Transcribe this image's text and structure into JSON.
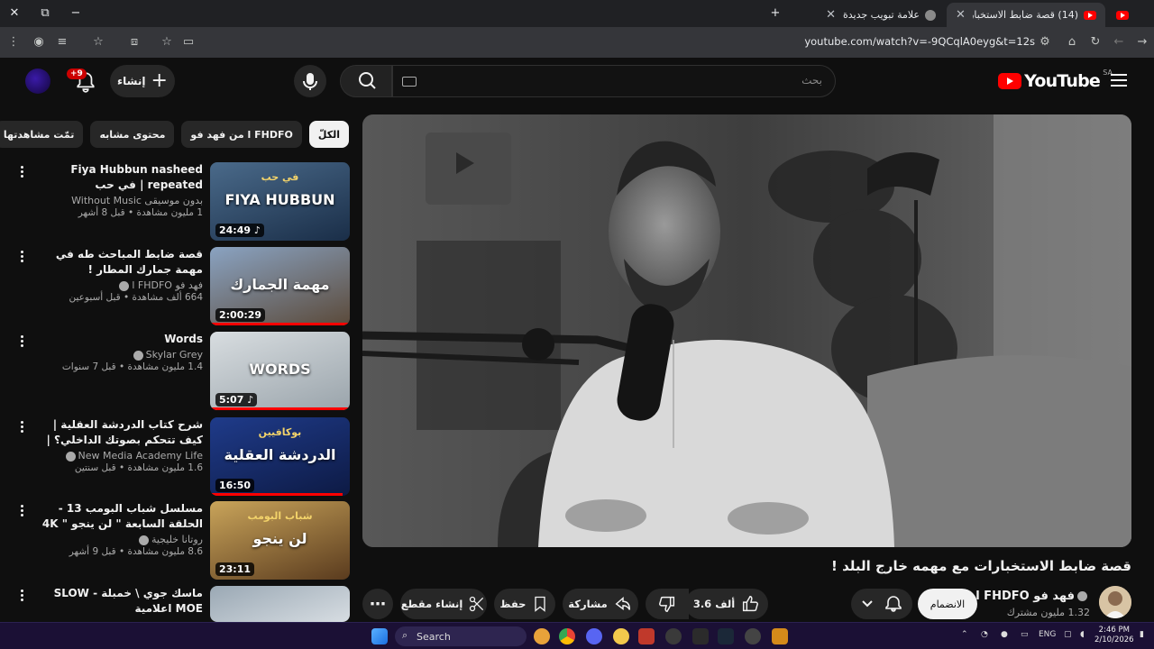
{
  "browser": {
    "tabs": [
      {
        "title": "(14) قصة ضابط الاستخبارات مع ...",
        "active": true
      },
      {
        "title": "علامة تبويب جديدة",
        "active": false
      }
    ],
    "url": "youtube.com/watch?v=-9QCqlA0eyg&t=12s"
  },
  "header": {
    "logo_text": "YouTube",
    "country_code": "SA",
    "search_placeholder": "بحث",
    "create_label": "إنشاء",
    "notification_count": "+9"
  },
  "chips": [
    {
      "label": "الكلّ",
      "active": true
    },
    {
      "label": "من فهد فو l FHDFO",
      "active": false
    },
    {
      "label": "محتوى مشابه",
      "active": false
    },
    {
      "label": "تمّت مشاهدتها",
      "active": false
    }
  ],
  "recommendations": [
    {
      "title": "Fiya Hubbun nasheed repeated | في حب",
      "channel": "بدون موسيقى Without Music",
      "verified": false,
      "stats": "1 مليون مشاهدة • قبل 8 أشهر",
      "duration": "24:49",
      "music": true,
      "thumb_text": "FIYA HUBBUN",
      "thumb_sub": "في حب",
      "thumb_colors": [
        "#4a6a8a",
        "#1a2e48"
      ],
      "watched_fraction": 0
    },
    {
      "title": "قصة ضابط المباحث طه في مهمة جمارك المطار !",
      "channel": "فهد فو l FHDFO",
      "verified": true,
      "stats": "664 ألف مشاهدة • قبل أسبوعين",
      "duration": "2:00:29",
      "music": false,
      "thumb_text": "مهمة الجمارك",
      "thumb_sub": "",
      "thumb_colors": [
        "#8aa3c2",
        "#5b4a3a"
      ],
      "watched_fraction": 1
    },
    {
      "title": "Words",
      "channel": "Skylar Grey",
      "verified": true,
      "stats": "1.4 مليون مشاهدة • قبل 7 سنوات",
      "duration": "5:07",
      "music": true,
      "thumb_text": "WORDS",
      "thumb_sub": "",
      "thumb_colors": [
        "#d8dde0",
        "#9aa4ab"
      ],
      "watched_fraction": 1
    },
    {
      "title": "شرح كتاب الدردشة العقلية | كيف تتحكم بصوتك الداخلي؟ | بوكافيين",
      "channel": "New Media Academy Life",
      "verified": true,
      "stats": "1.6 مليون مشاهدة • قبل سنتين",
      "duration": "16:50",
      "music": false,
      "thumb_text": "الدردشة العقلية",
      "thumb_sub": "بوكافيين",
      "thumb_colors": [
        "#1f3b8a",
        "#0d1a44"
      ],
      "watched_fraction": 0.95
    },
    {
      "title": "مسلسل شباب البومب 13 - الحلقة السابعة \" لن ينجو \" 4K",
      "channel": "روتانا خليجية",
      "verified": true,
      "stats": "8.6 مليون مشاهدة • قبل 9 أشهر",
      "duration": "23:11",
      "music": false,
      "thumb_text": "لن ينجو",
      "thumb_sub": "شباب البومب",
      "thumb_colors": [
        "#c9a45a",
        "#5a3b1e"
      ],
      "watched_fraction": 0
    },
    {
      "title": "ماسك جوي \\ خمبلة - SLOW MOE اعلامية",
      "channel": "",
      "verified": false,
      "stats": "",
      "duration": "",
      "music": false,
      "thumb_text": "",
      "thumb_sub": "",
      "thumb_colors": [
        "#9aa8b4",
        "#d7dde2"
      ],
      "watched_fraction": 0
    }
  ],
  "video": {
    "title": "قصة ضابط الاستخبارات مع مهمه خارج البلد !",
    "channel_name": "فهد فو l FHDFO",
    "subscribers": "1.32 مليون مشترك",
    "join_label": "الانضمام",
    "likes": "3.6 ألف",
    "share_label": "مشاركة",
    "save_label": "حفظ",
    "clip_label": "إنشاء مقطع"
  },
  "taskbar": {
    "search_label": "Search",
    "lang": "ENG",
    "time": "2:46 PM",
    "date": "2/10/2026"
  },
  "colors": {
    "background": "#0f0f0f",
    "accent": "#ff0000",
    "chip_bg": "#272727"
  }
}
